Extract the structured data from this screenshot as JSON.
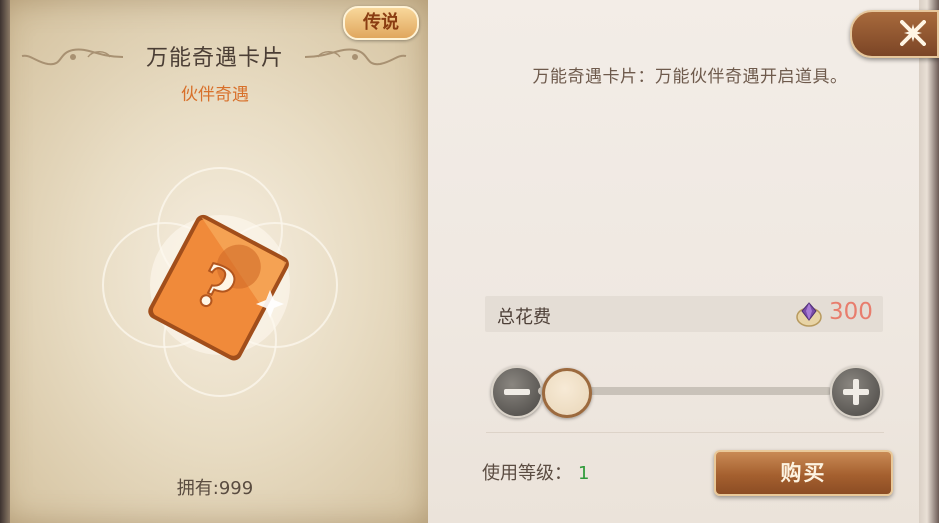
{
  "item": {
    "rarity": "传说",
    "name": "万能奇遇卡片",
    "category": "伙伴奇遇",
    "owned": "拥有:999",
    "art_icon": "question-mark-card-icon"
  },
  "detail": {
    "description": "万能奇遇卡片：万能伙伴奇遇开启道具。"
  },
  "cost": {
    "label": "总花费",
    "value": "300",
    "currency_icon": "purple-gem-coin-icon"
  },
  "quantity_slider": {
    "position": 0.0
  },
  "requirement": {
    "label": "使用等级：",
    "value": "1"
  },
  "actions": {
    "buy_label": "购买",
    "close_icon": "close-x-icon"
  },
  "colors": {
    "cost_value": "#e87d6d",
    "level_value": "#2f9a3a",
    "category": "#d8702a"
  }
}
